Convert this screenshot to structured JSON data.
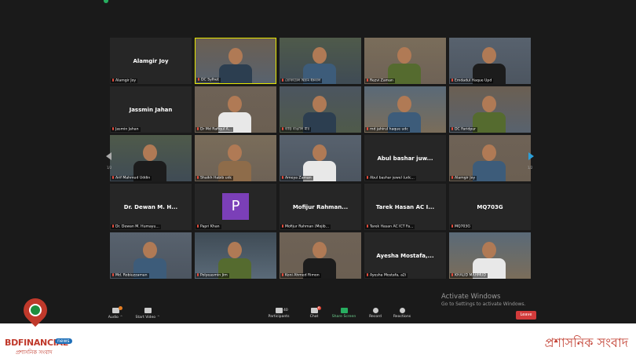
{
  "gallery": {
    "tiles": [
      {
        "label": "Alamgir Joy",
        "center_name": "Alamgir Joy",
        "type": "name"
      },
      {
        "label": "DC Sylhet",
        "type": "video",
        "active": true
      },
      {
        "label": "তোফায়েল হিয়াম ইকবাল",
        "type": "video"
      },
      {
        "label": "Rezvi Zaman",
        "type": "video"
      },
      {
        "label": "Emdadul Haque Upd",
        "type": "video"
      },
      {
        "label": "Jasmin Jahan",
        "center_name": "Jassmin Jahan",
        "type": "name"
      },
      {
        "label": "Dr Md Rafiqul A...",
        "type": "video"
      },
      {
        "label": "বাড়ি বাঙালি মীর",
        "type": "video"
      },
      {
        "label": "md jahirul haque udc",
        "type": "video"
      },
      {
        "label": "DC Faridpur",
        "type": "video"
      },
      {
        "label": "Arif Mahmud Uddin",
        "type": "video"
      },
      {
        "label": "Shaikh Habib udc",
        "type": "video"
      },
      {
        "label": "Ameya Zaman",
        "type": "video"
      },
      {
        "label": "Abul bashar jewel (udc...",
        "center_name": "Abul bashar juw...",
        "type": "name"
      },
      {
        "label": "Alamgir Joy",
        "type": "video"
      },
      {
        "label": "Dr. Dewan M. Humayu...",
        "center_name": "Dr. Dewan M. H...",
        "type": "name"
      },
      {
        "label": "Papri Khan",
        "type": "avatar",
        "avatar_letter": "P"
      },
      {
        "label": "Mofijur Rahman (Mojib...",
        "center_name": "Mofijur Rahman...",
        "type": "name"
      },
      {
        "label": "Tarek Hasan AC ICT Fa...",
        "center_name": "Tarek Hasan AC I...",
        "type": "name"
      },
      {
        "label": "MQ703G",
        "center_name": "MQ703G",
        "type": "name"
      },
      {
        "label": "Md. Robiuzzaman",
        "type": "video"
      },
      {
        "label": "Polyeasmin Jim",
        "type": "video"
      },
      {
        "label": "Koni Ahmed Rimon",
        "type": "video"
      },
      {
        "label": "Ayesha Mostafa, a2i",
        "center_name": "Ayesha Mostafa,...",
        "type": "name"
      },
      {
        "label": "KHALID MAHMUD",
        "type": "video"
      }
    ],
    "page_left": "1/2",
    "page_right": "1/2"
  },
  "toolbar": {
    "audio": "Audio",
    "start_video": "Start Video",
    "participants": "Participants",
    "participants_count": "40",
    "chat": "Chat",
    "chat_badge": "6",
    "share_screen": "Share Screen",
    "record": "Record",
    "reactions": "Reactions",
    "leave": "Leave"
  },
  "watermark": {
    "line1": "Activate Windows",
    "line2": "Go to Settings to activate Windows."
  },
  "branding": {
    "logo_name": "BDFINANCIAL",
    "logo_badge": "news",
    "logo_sub": "প্রশাসনিক সংবাদ",
    "banner_title": "প্রশাসনিক সংবাদ"
  },
  "colors": {
    "background": "#1a1a1a",
    "tile": "#262626",
    "active_border": "#e6e600",
    "leave": "#d23b3b",
    "brand_red": "#c0392b",
    "share_green": "#27ae60"
  }
}
